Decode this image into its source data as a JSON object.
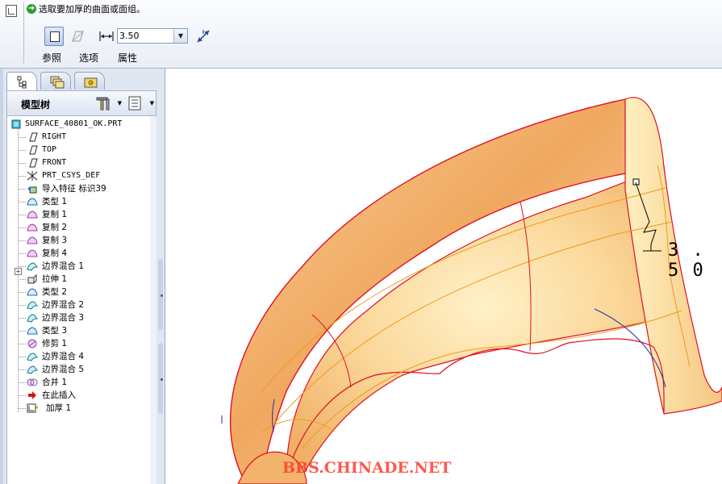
{
  "dashboard": {
    "prompt": "选取要加厚的曲面或面组。",
    "thickness_value": "3.50",
    "tabs": [
      "参照",
      "选项",
      "属性"
    ]
  },
  "navigator": {
    "tree_title": "模型树",
    "root": "SURFACE_40801_OK.PRT",
    "items": [
      {
        "label": "RIGHT",
        "icon": "datum-plane-icon"
      },
      {
        "label": "TOP",
        "icon": "datum-plane-icon"
      },
      {
        "label": "FRONT",
        "icon": "datum-plane-icon"
      },
      {
        "label": "PRT_CSYS_DEF",
        "icon": "csys-icon"
      },
      {
        "label": "导入特征 标识39",
        "icon": "import-feature-icon"
      },
      {
        "label": "类型 1",
        "icon": "surface-type-icon"
      },
      {
        "label": "复制 1",
        "icon": "copy-surface-icon"
      },
      {
        "label": "复制 2",
        "icon": "copy-surface-icon"
      },
      {
        "label": "复制 3",
        "icon": "copy-surface-icon"
      },
      {
        "label": "复制 4",
        "icon": "copy-surface-icon"
      },
      {
        "label": "边界混合 1",
        "icon": "boundary-blend-icon"
      },
      {
        "label": "拉伸 1",
        "icon": "extrude-icon"
      },
      {
        "label": "类型 2",
        "icon": "surface-type-icon"
      },
      {
        "label": "边界混合 2",
        "icon": "boundary-blend-icon"
      },
      {
        "label": "边界混合 3",
        "icon": "boundary-blend-icon"
      },
      {
        "label": "类型 3",
        "icon": "surface-type-icon"
      },
      {
        "label": "修剪 1",
        "icon": "trim-icon"
      },
      {
        "label": "边界混合 4",
        "icon": "boundary-blend-icon"
      },
      {
        "label": "边界混合 5",
        "icon": "boundary-blend-icon"
      },
      {
        "label": "合并 1",
        "icon": "merge-icon"
      },
      {
        "label": "在此插入",
        "icon": "insert-here-arrow-icon"
      },
      {
        "label": "加厚 1",
        "icon": "thicken-icon"
      }
    ]
  },
  "graphics": {
    "dimension_label": "3.50",
    "watermark": "BBS.CHINADE.NET"
  },
  "colors": {
    "surface": "#f6b777",
    "edge_red": "#e01020",
    "edge_orange": "#f09a1a",
    "accent_blue": "#2a2aa8",
    "watermark": "#ff3d2e"
  }
}
